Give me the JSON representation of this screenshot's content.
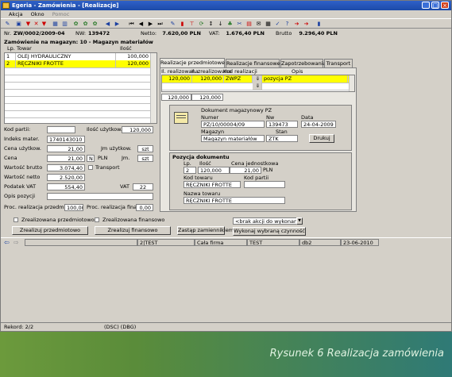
{
  "window": {
    "title": "Egeria - Zamówienia - [Realizacje]"
  },
  "menu": [
    "Akcja",
    "Okno",
    "Pomoc"
  ],
  "info": {
    "nr_label": "Nr.",
    "nr": "ZW/0002/2009-04",
    "nw_label": "NW:",
    "nw": "139472",
    "netto_label": "Netto:",
    "netto": "7.620,00 PLN",
    "vat_label": "VAT:",
    "vat": "1.676,40 PLN",
    "brutto_label": "Brutto:",
    "brutto": "9.296,40 PLN"
  },
  "left": {
    "heading": "Zamówienie na magazyn: 10 - Magazyn materiałów",
    "columns": {
      "lp": "Lp.",
      "towar": "Towar",
      "ilosc": "Ilość"
    },
    "rows": [
      {
        "lp": "1",
        "towar": "OLEJ HYDRAULICZNY",
        "ilosc": "100,000"
      },
      {
        "lp": "2",
        "towar": "RĘCZNIKI FROTTE",
        "ilosc": "120,000"
      }
    ],
    "kod_partii_label": "Kod partii:",
    "ilosc_uzytkow_label": "Ilość użytkow.",
    "ilosc_uzytkow": "120,000",
    "indeks_label": "Indeks mater.",
    "indeks": "1740143010",
    "cena_uzytkow_label": "Cena użytkow.",
    "cena_uzytkow": "21,00",
    "jm_uzytkow_label": "Jm użytkow.",
    "jm_uzytkow": "szt",
    "cena_label": "Cena",
    "cena": "21,00",
    "waluta": "N",
    "pln": "PLN",
    "jm_label": "Jm.",
    "jm": "szt",
    "wartosc_brutto_label": "Wartość brutto",
    "wartosc_brutto": "3.074,40",
    "transport_label": "Transport",
    "wartosc_netto_label": "Wartość netto",
    "wartosc_netto": "2.520,00",
    "podatek_label": "Podatek VAT",
    "podatek": "554,40",
    "vat_label": "VAT",
    "vat": "22",
    "opis_label": "Opis pozycji",
    "proc_przedm_label": "Proc. realizacja przedm.",
    "proc_przedm": "100,00",
    "proc_finans_label": "Proc. realizacja finans.",
    "proc_finans": "0,00"
  },
  "tabs": [
    "Realizacje przedmiotowe",
    "Realizacje finansowe",
    "Zapotrzebowania",
    "Transport"
  ],
  "real_grid": {
    "columns": [
      "Il. realizowana",
      "Il. zrealizowana",
      "Kod realizacji",
      "",
      "Opis"
    ],
    "rows": [
      {
        "il_realiz": "120,000",
        "il_zreal": "120,000",
        "kod": "ZWPZ",
        "opis": "pozycja PZ"
      }
    ],
    "total_a": "120,000",
    "total_b": "120,000"
  },
  "document": {
    "title": "Dokument magazynowy PZ",
    "numer_label": "Numer",
    "numer": "PZ/10/00004/09",
    "nw_label": "Nw",
    "nw": "139473",
    "data_label": "Data",
    "data": "24-04-2009",
    "magazyn_label": "Magazyn",
    "magazyn": "Magazyn materiałów",
    "stan_label": "Stan",
    "stan": "ZTK",
    "drukuj": "Drukuj"
  },
  "position": {
    "title": "Pozycja dokumentu",
    "lp_label": "Lp.",
    "lp": "2",
    "ilosc_label": "Ilość",
    "ilosc": "120,000",
    "cena_label": "Cena jednostkowa",
    "cena": "21,00",
    "pln": "PLN",
    "kod_towaru_label": "Kod towaru",
    "kod_towaru": "RĘCZNIKI FROTTE",
    "kod_partii_label": "Kod partii",
    "kod_partii": "",
    "nazwa_label": "Nazwa towaru",
    "nazwa": "RĘCZNIKI FROTTE"
  },
  "actions": {
    "zreal_przedm_label": "Zrealizowana przedmiotowo",
    "zreal_finans_label": "Zrealizowana finansowo",
    "btn_przedm": "Zrealizuj przedmiotowo",
    "btn_finans": "Zrealizuj finansowo",
    "btn_zamien": "Zastąp zamiennikiem",
    "akcja_select": "<brak akcji do wykonania>",
    "btn_wykonaj": "Wykonaj wybraną czynność"
  },
  "statusbar": {
    "pos": "2",
    "user": "TEST",
    "firma": "Cała firma",
    "user2": "TEST",
    "db": "db2",
    "date": "23-06-2010"
  },
  "bottom": {
    "rekord": "Rekord: 2/2",
    "dsc": "(DSC) (DBG)"
  },
  "caption": "Rysunek 6 Realizacja zamówienia"
}
